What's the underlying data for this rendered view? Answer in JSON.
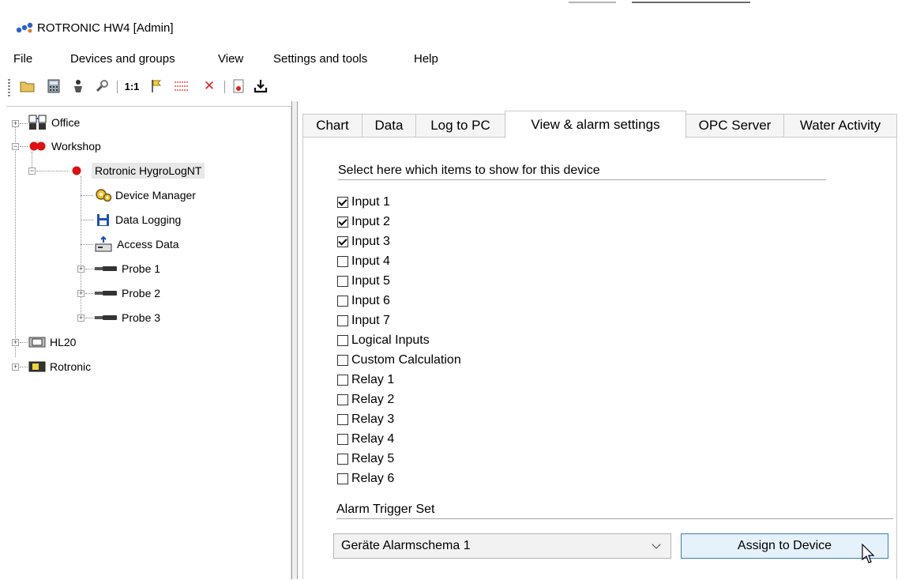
{
  "window": {
    "title": "ROTRONIC HW4 [Admin]"
  },
  "menu": [
    "File",
    "Devices and groups",
    "View",
    "Settings and tools",
    "Help"
  ],
  "toolbar": {
    "ratio_label": "1:1"
  },
  "tree": {
    "nodes": [
      {
        "label": "Office"
      },
      {
        "label": "Workshop"
      },
      {
        "label": "Rotronic HygroLogNT"
      },
      {
        "label": "Device Manager"
      },
      {
        "label": "Data Logging"
      },
      {
        "label": "Access Data"
      },
      {
        "label": "Probe 1"
      },
      {
        "label": "Probe 2"
      },
      {
        "label": "Probe 3"
      },
      {
        "label": "HL20"
      },
      {
        "label": "Rotronic"
      }
    ]
  },
  "tabs": [
    "Chart",
    "Data",
    "Log to PC",
    "View & alarm settings",
    "OPC Server",
    "Water Activity"
  ],
  "active_tab": "View & alarm settings",
  "panel": {
    "items_heading": "Select here which items to show for this device",
    "items": [
      {
        "label": "Input 1",
        "checked": true
      },
      {
        "label": "Input 2",
        "checked": true
      },
      {
        "label": "Input 3",
        "checked": true
      },
      {
        "label": "Input 4",
        "checked": false
      },
      {
        "label": "Input 5",
        "checked": false
      },
      {
        "label": "Input 6",
        "checked": false
      },
      {
        "label": "Input 7",
        "checked": false
      },
      {
        "label": "Logical Inputs",
        "checked": false
      },
      {
        "label": "Custom Calculation",
        "checked": false
      },
      {
        "label": "Relay 1",
        "checked": false
      },
      {
        "label": "Relay 2",
        "checked": false
      },
      {
        "label": "Relay 3",
        "checked": false
      },
      {
        "label": "Relay 4",
        "checked": false
      },
      {
        "label": "Relay 5",
        "checked": false
      },
      {
        "label": "Relay 6",
        "checked": false
      }
    ],
    "alarm_heading": "Alarm Trigger Set",
    "alarm_select_value": "Geräte Alarmschema 1",
    "assign_button": "Assign to Device"
  },
  "colors": {
    "accent_button_border": "#3c7fb1",
    "accent_button_bg": "#e5f1fb",
    "status_red": "#e01010"
  }
}
